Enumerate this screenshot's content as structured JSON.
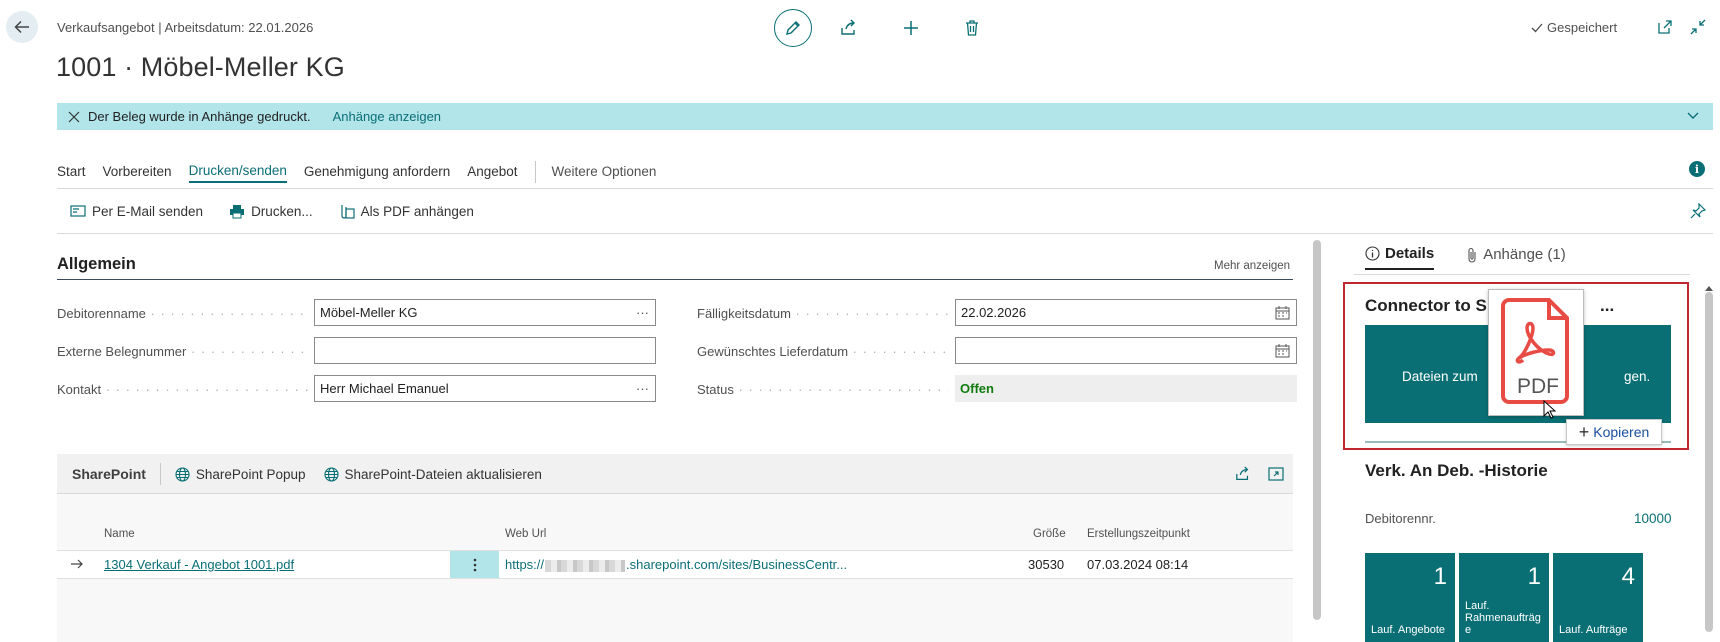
{
  "header": {
    "breadcrumb": "Verkaufsangebot | Arbeitsdatum: 22.01.2026",
    "title": "1001 · Möbel-Meller KG",
    "saved_label": "Gespeichert"
  },
  "notification": {
    "message": "Der Beleg wurde in Anhänge gedruckt.",
    "link": "Anhänge anzeigen"
  },
  "action_tabs": {
    "items": [
      "Start",
      "Vorbereiten",
      "Drucken/senden",
      "Genehmigung anfordern",
      "Angebot"
    ],
    "active": "Drucken/senden",
    "more": "Weitere Optionen"
  },
  "sub_actions": {
    "email": "Per E-Mail senden",
    "print": "Drucken...",
    "pdf": "Als PDF anhängen"
  },
  "general": {
    "title": "Allgemein",
    "show_more": "Mehr anzeigen",
    "debitorenname_label": "Debitorenname",
    "debitorenname_value": "Möbel-Meller KG",
    "externe_label": "Externe Belegnummer",
    "externe_value": "",
    "kontakt_label": "Kontakt",
    "kontakt_value": "Herr Michael Emanuel",
    "faellig_label": "Fälligkeitsdatum",
    "faellig_value": "22.02.2026",
    "liefer_label": "Gewünschtes Lieferdatum",
    "liefer_value": "",
    "status_label": "Status",
    "status_value": "Offen",
    "ellipsis": "···"
  },
  "sharepoint": {
    "title": "SharePoint",
    "popup": "SharePoint Popup",
    "refresh": "SharePoint-Dateien aktualisieren",
    "columns": {
      "name": "Name",
      "weburl": "Web Url",
      "size": "Größe",
      "created": "Erstellungszeitpunkt"
    },
    "rows": [
      {
        "name": "1304 Verkauf - Angebot 1001.pdf",
        "url_prefix": "https://",
        "url_suffix": ".sharepoint.com/sites/BusinessCentr...",
        "size": "30530",
        "created": "07.03.2024 08:14"
      }
    ]
  },
  "factbox": {
    "tab_details": "Details",
    "tab_attachments": "Anhänge (1)",
    "connector_title_start": "Connector to S",
    "connector_title_end": "...",
    "dropzone_text_start": "Dateien zum",
    "dropzone_text_end": "gen.",
    "pdf_icon_label": "PDF",
    "copy_tooltip": "Kopieren",
    "history_title": "Verk. An Deb. -Historie",
    "debitor_label": "Debitorennr.",
    "debitor_value": "10000",
    "cues": [
      {
        "value": "1",
        "label": "Lauf. Angebote"
      },
      {
        "value": "1",
        "label": "Lauf. Rahmenaufträg e"
      },
      {
        "value": "4",
        "label": "Lauf. Aufträge"
      }
    ]
  },
  "colors": {
    "accent": "#0a6f75",
    "notification_bg": "#b2e5ea",
    "status_green": "#107c10",
    "highlight_red": "#c0262d"
  }
}
